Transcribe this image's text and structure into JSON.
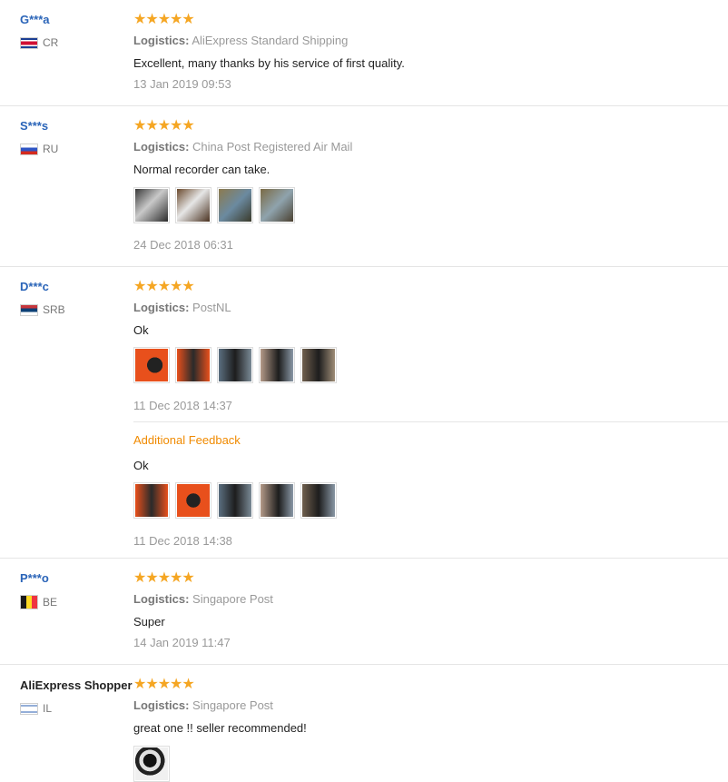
{
  "stars_glyph": "★★★★★",
  "logistics_prefix": "Logistics:",
  "reviews": [
    {
      "name": "G***a",
      "country": "CR",
      "logistics": "AliExpress Standard Shipping",
      "text": "Excellent, many thanks by his service of first quality.",
      "date": "13 Jan 2019 09:53"
    },
    {
      "name": "S***s",
      "country": "RU",
      "logistics": "China Post Registered Air Mail",
      "text": "Normal recorder can take.",
      "date": "24 Dec 2018 06:31"
    },
    {
      "name": "D***c",
      "country": "SRB",
      "logistics": "PostNL",
      "text": "Ok",
      "date": "11 Dec 2018 14:37",
      "additional_label": "Additional Feedback",
      "additional_text": "Ok",
      "additional_date": "11 Dec 2018 14:38"
    },
    {
      "name": "P***o",
      "country": "BE",
      "logistics": "Singapore Post",
      "text": "Super",
      "date": "14 Jan 2019 11:47"
    },
    {
      "name": "AliExpress Shopper",
      "country": "IL",
      "logistics": "Singapore Post",
      "text": "great one !! seller recommended!"
    }
  ],
  "colors": {
    "name_link": "#2a64b8",
    "star": "#f5a623",
    "additional_feedback": "#f08a00",
    "muted": "#999999"
  }
}
